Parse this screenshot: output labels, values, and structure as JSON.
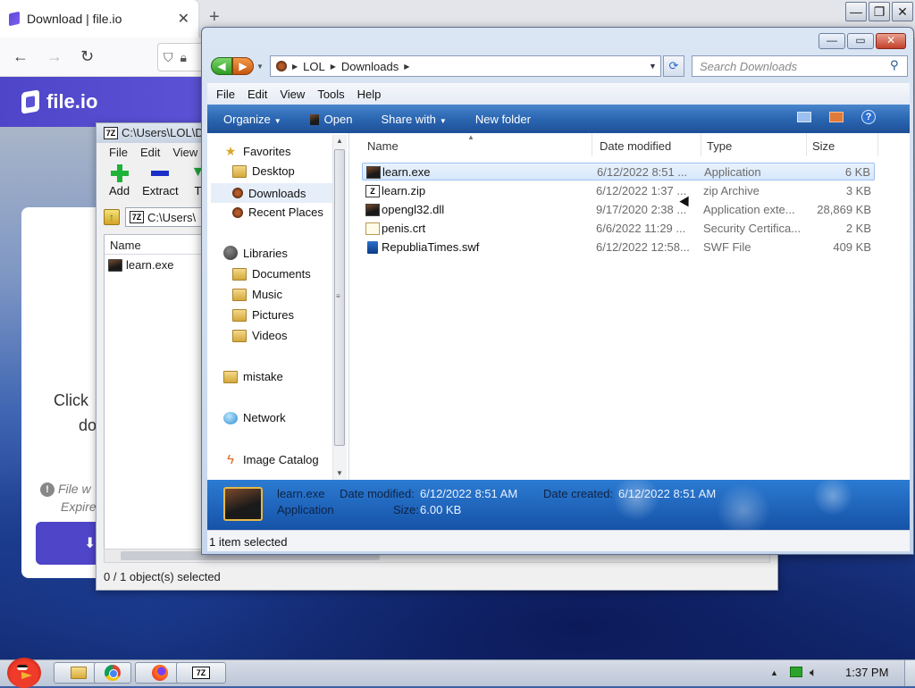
{
  "browser": {
    "tab_title": "Download | file.io",
    "tab_close": "✕",
    "new_tab": "+",
    "nav_back": "←",
    "nav_forward": "→",
    "nav_reload": "↻",
    "window_controls": {
      "minimize": "—",
      "maximize": "❐",
      "close": "✕"
    }
  },
  "fileio": {
    "brand": "file.io",
    "click_text": "Click",
    "do_text": "do",
    "info_line1": "File w",
    "info_line2": "Expire",
    "download_arrow": "⬇"
  },
  "sevenzip": {
    "title": "C:\\Users\\LOL\\D",
    "app_icon": "7Z",
    "menu": [
      "File",
      "Edit",
      "View"
    ],
    "toolbar": {
      "add": "Add",
      "extract": "Extract",
      "test": "T"
    },
    "address": "C:\\Users\\",
    "column_name": "Name",
    "file": "learn.exe",
    "status": "0 / 1 object(s) selected"
  },
  "explorer": {
    "controls": {
      "minimize": "—",
      "maximize": "▭",
      "close": "✕"
    },
    "breadcrumb": [
      "LOL",
      "Downloads"
    ],
    "search_placeholder": "Search Downloads",
    "menu": [
      "File",
      "Edit",
      "View",
      "Tools",
      "Help"
    ],
    "commands": {
      "organize": "Organize",
      "open": "Open",
      "share_with": "Share with",
      "new_folder": "New folder"
    },
    "nav": {
      "favorites": "Favorites",
      "desktop": "Desktop",
      "downloads": "Downloads",
      "recent_places": "Recent Places",
      "libraries": "Libraries",
      "documents": "Documents",
      "music": "Music",
      "pictures": "Pictures",
      "videos": "Videos",
      "mistake": "mistake",
      "network": "Network",
      "image_catalog": "Image Catalog"
    },
    "columns": {
      "name": "Name",
      "date_modified": "Date modified",
      "type": "Type",
      "size": "Size"
    },
    "files": [
      {
        "name": "learn.exe",
        "date": "6/12/2022 8:51 ...",
        "type": "Application",
        "size": "6 KB",
        "icon": "exe-icon"
      },
      {
        "name": "learn.zip",
        "date": "6/12/2022 1:37 ...",
        "type": "zip Archive",
        "size": "3 KB",
        "icon": "zip-archive-icon"
      },
      {
        "name": "opengl32.dll",
        "date": "9/17/2020 2:38 ...",
        "type": "Application exte...",
        "size": "28,869 KB",
        "icon": "dll-icon"
      },
      {
        "name": "penis.crt",
        "date": "6/6/2022 11:29 ...",
        "type": "Security Certifica...",
        "size": "2 KB",
        "icon": "certificate-icon"
      },
      {
        "name": "RepubliaTimes.swf",
        "date": "6/12/2022 12:58...",
        "type": "SWF File",
        "size": "409 KB",
        "icon": "swf-icon"
      }
    ],
    "details": {
      "name": "learn.exe",
      "type": "Application",
      "modified_label": "Date modified:",
      "modified_value": "6/12/2022 8:51 AM",
      "size_label": "Size:",
      "size_value": "6.00 KB",
      "created_label": "Date created:",
      "created_value": "6/12/2022 8:51 AM"
    },
    "status": "1 item selected"
  },
  "taskbar": {
    "sevenzip_label": "7Z",
    "clock": "1:37 PM"
  },
  "colors": {
    "fileio_brand": "#4f45c8",
    "command_bar": "#2d69b4",
    "selection": "#d6e7fb"
  }
}
